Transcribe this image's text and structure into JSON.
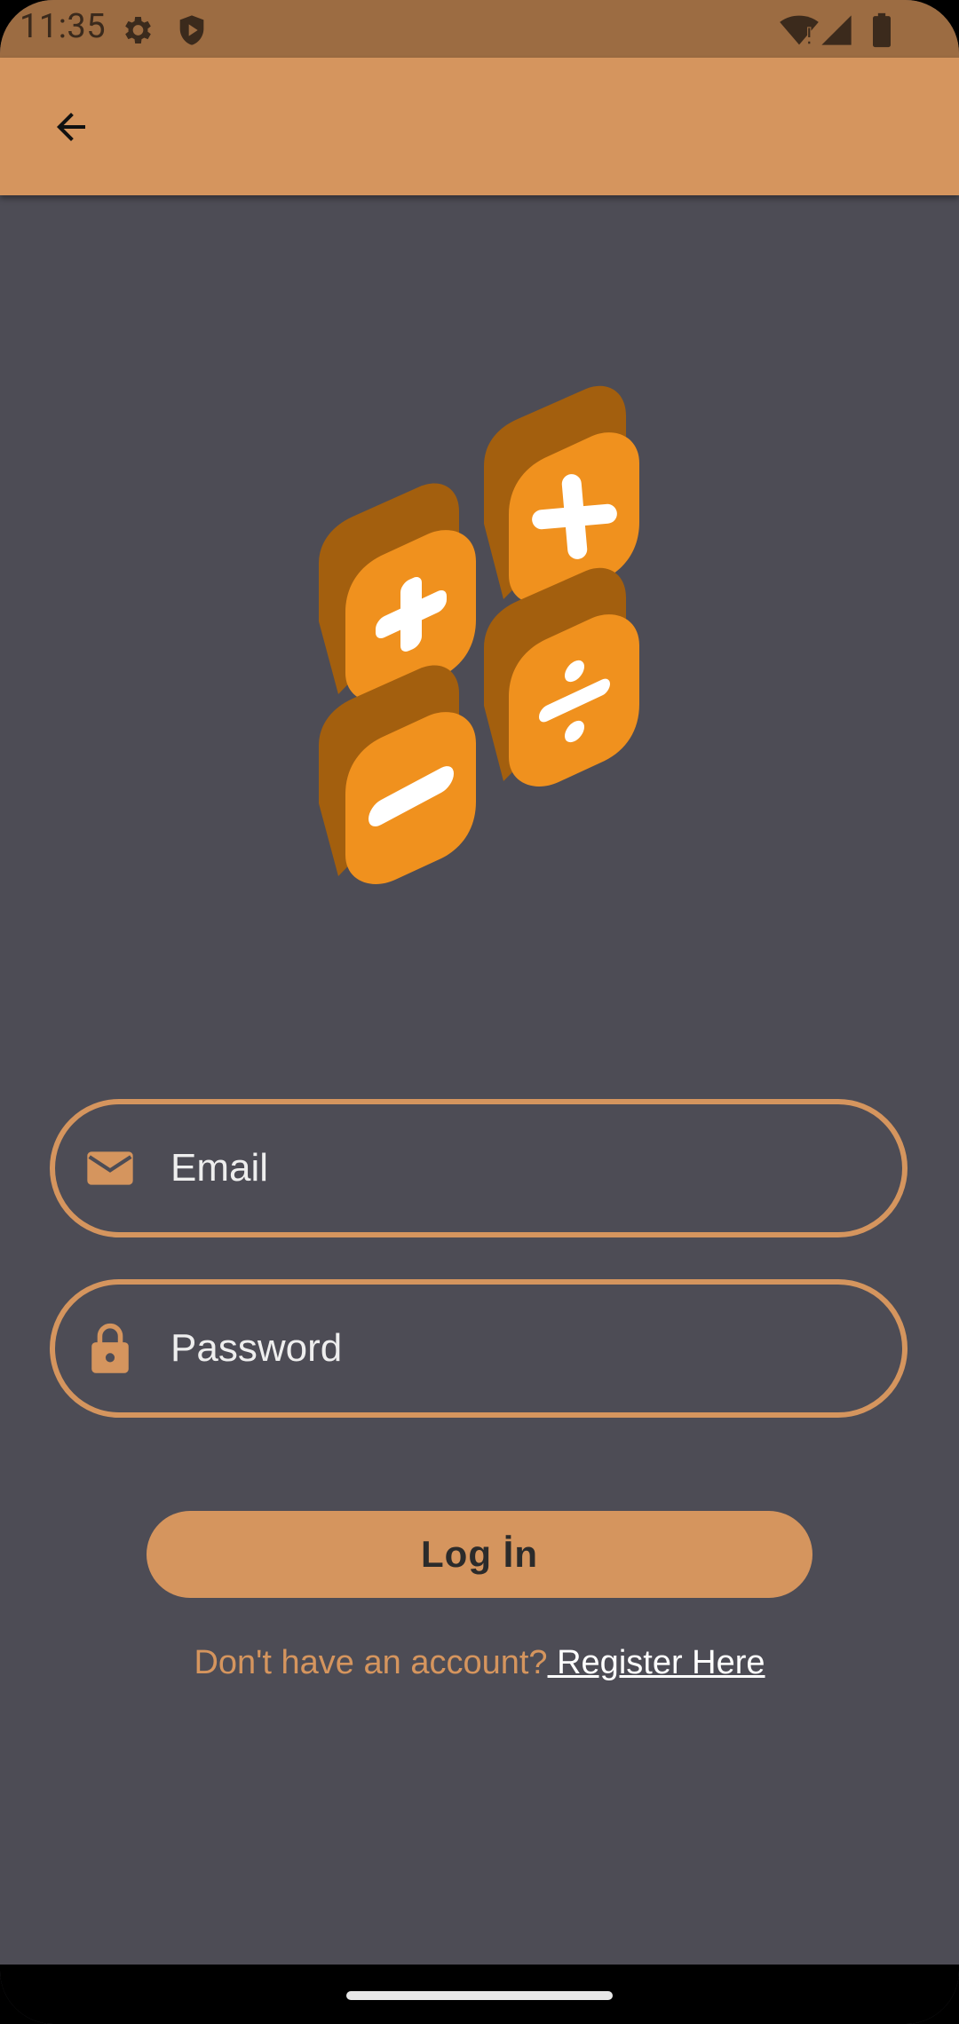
{
  "status_bar": {
    "time": "11:35",
    "icons": [
      "settings-icon",
      "shield-play-icon",
      "wifi-icon",
      "signal-icon",
      "battery-icon"
    ]
  },
  "app_bar": {
    "back_icon": "arrow-left-icon"
  },
  "logo": {
    "icon": "math-operators-logo",
    "symbols": [
      "+",
      "×",
      "−",
      "÷"
    ]
  },
  "form": {
    "email": {
      "placeholder": "Email",
      "value": "",
      "icon": "mail-icon"
    },
    "password": {
      "placeholder": "Password",
      "value": "",
      "icon": "lock-icon"
    },
    "login_label": "Log İn",
    "register_prompt": "Don't have an account?",
    "register_link": " Register Here"
  },
  "colors": {
    "accent": "#d5955e",
    "status_bar": "#9c6c42",
    "background": "#4d4c55",
    "tile_orange": "#f0911e",
    "tile_dark": "#a35f0e"
  }
}
